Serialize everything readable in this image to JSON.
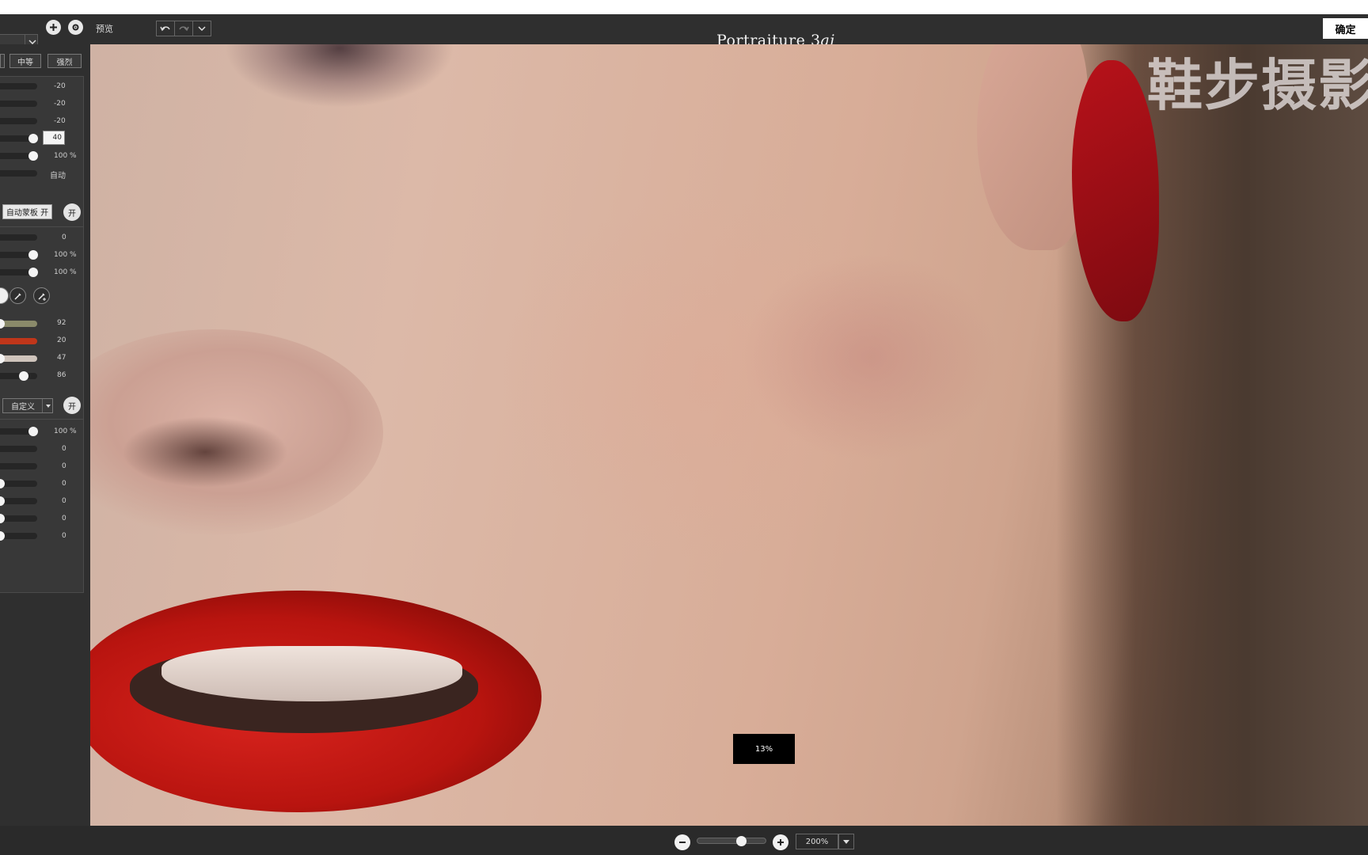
{
  "app": {
    "title_main": "Portraiture 3",
    "title_suffix": "ai",
    "ok_label": "确定"
  },
  "toolbar": {
    "preview_label": "预览"
  },
  "presets": {
    "items": [
      "中等",
      "强烈"
    ]
  },
  "smoothing": {
    "rows": [
      {
        "value": "-20",
        "unit": ""
      },
      {
        "value": "-20",
        "unit": ""
      },
      {
        "value": "-20",
        "unit": ""
      },
      {
        "value": "40",
        "unit": ""
      },
      {
        "value": "100",
        "unit": "%"
      },
      {
        "value": "自动",
        "unit": ""
      }
    ]
  },
  "mask": {
    "auto_button": "自动蒙板 开",
    "toggle_label": "开",
    "rows": [
      {
        "value": "0",
        "unit": ""
      },
      {
        "value": "100",
        "unit": "%"
      },
      {
        "value": "100",
        "unit": "%"
      }
    ],
    "color_rows": [
      {
        "value": "92",
        "color": "#8a8a6a"
      },
      {
        "value": "20",
        "color": "#c0361a"
      },
      {
        "value": "47",
        "color": "#cfc4bc"
      },
      {
        "value": "86",
        "color": "#262626"
      }
    ]
  },
  "enhance": {
    "preset": "自定义",
    "toggle_label": "开",
    "rows": [
      {
        "value": "100",
        "unit": "%"
      },
      {
        "value": "0",
        "unit": ""
      },
      {
        "value": "0",
        "unit": ""
      },
      {
        "value": "0",
        "unit": ""
      },
      {
        "value": "0",
        "unit": ""
      },
      {
        "value": "0",
        "unit": ""
      },
      {
        "value": "0",
        "unit": ""
      }
    ]
  },
  "canvas": {
    "watermark": "鞋步摄影",
    "progress_text": "13%"
  },
  "zoom": {
    "value": "200%"
  }
}
